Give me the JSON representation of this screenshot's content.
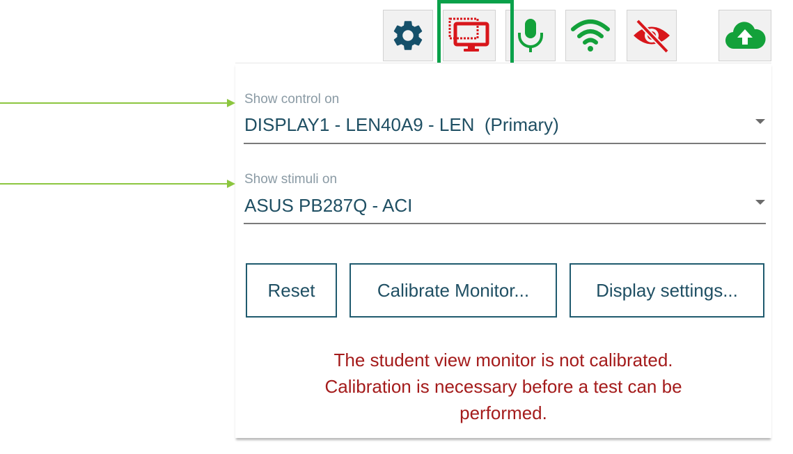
{
  "toolbar": {
    "icons": [
      {
        "name": "gear-icon",
        "color": "#15506a"
      },
      {
        "name": "monitor-icon",
        "color": "#d8161b",
        "selected": true
      },
      {
        "name": "microphone-icon",
        "color": "#13a13a"
      },
      {
        "name": "wifi-icon",
        "color": "#13a13a"
      },
      {
        "name": "eye-slash-icon",
        "color": "#d8161b"
      },
      {
        "name": "cloud-upload-icon",
        "color": "#13a13a"
      }
    ],
    "highlight_color": "#0aa14a"
  },
  "form": {
    "control_label": "Show control on",
    "control_value": "DISPLAY1 - LEN40A9 - LEN  (Primary)",
    "stimuli_label": "Show stimuli on",
    "stimuli_value": "ASUS PB287Q - ACI"
  },
  "buttons": {
    "reset": "Reset",
    "calibrate": "Calibrate Monitor...",
    "display_settings": "Display settings..."
  },
  "warning": {
    "line1": "The student view monitor is not calibrated.",
    "line2": "Calibration is necessary before a test can be",
    "line3": "performed.",
    "color": "#a41b1b"
  },
  "annotations": {
    "arrow_color": "#8cc63f"
  }
}
